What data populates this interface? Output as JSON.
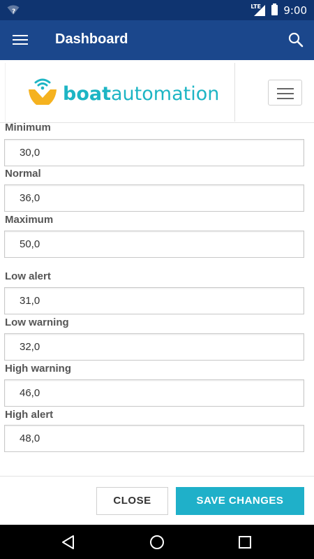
{
  "status_bar": {
    "time": "9:00",
    "network": "LTE",
    "icons": [
      "wifi-question-icon",
      "lte-signal-icon",
      "battery-icon"
    ]
  },
  "app_bar": {
    "title": "Dashboard",
    "menu_icon": "menu-icon",
    "search_icon": "search-icon"
  },
  "header": {
    "logo_text_bold": "boat",
    "logo_text_light": "automation",
    "logo_icon": "boat-wifi-logo-icon",
    "menu_toggle_icon": "hamburger-icon"
  },
  "fields": [
    {
      "label": "Minimum",
      "value": "30,0"
    },
    {
      "label": "Normal",
      "value": "36,0"
    },
    {
      "label": "Maximum",
      "value": "50,0"
    },
    {
      "label": "Low alert",
      "value": "31,0"
    },
    {
      "label": "Low warning",
      "value": "32,0"
    },
    {
      "label": "High warning",
      "value": "46,0"
    },
    {
      "label": "High alert",
      "value": "48,0"
    }
  ],
  "footer": {
    "close_label": "CLOSE",
    "save_label": "SAVE CHANGES"
  },
  "colors": {
    "status_bar": "#0f3470",
    "app_bar": "#1b478c",
    "accent": "#1fb0c9",
    "logo_teal": "#1db5c4",
    "logo_yellow": "#f5b21f"
  },
  "nav_bar": {
    "icons": [
      "back-icon",
      "home-icon",
      "recents-icon"
    ]
  }
}
